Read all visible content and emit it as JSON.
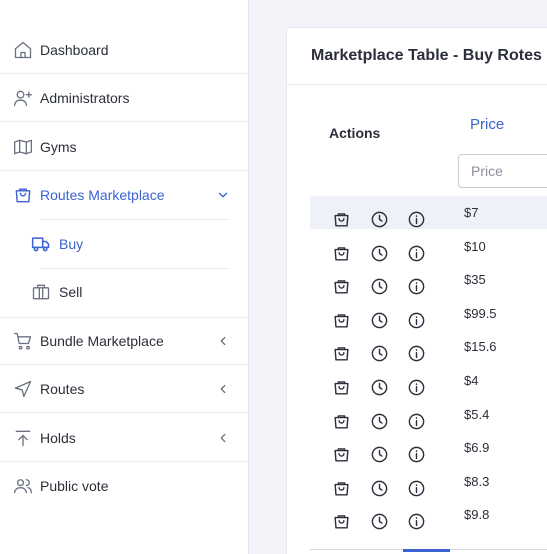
{
  "sidebar": {
    "items": [
      {
        "label": "Dashboard",
        "icon": "home-icon"
      },
      {
        "label": "Administrators",
        "icon": "user-plus-icon"
      },
      {
        "label": "Gyms",
        "icon": "map-icon"
      },
      {
        "label": "Routes Marketplace",
        "icon": "shopping-bag-icon",
        "expanded": true
      },
      {
        "label": "Bundle Marketplace",
        "icon": "shopping-cart-icon"
      },
      {
        "label": "Routes",
        "icon": "navigation-icon"
      },
      {
        "label": "Holds",
        "icon": "upload-icon"
      },
      {
        "label": "Public vote",
        "icon": "users-icon"
      }
    ],
    "subitems": [
      {
        "label": "Buy",
        "icon": "truck-icon",
        "active": true
      },
      {
        "label": "Sell",
        "icon": "briefcase-icon"
      }
    ],
    "accent_color": "#3b63d1"
  },
  "main": {
    "title": "Marketplace Table - Buy Rotes",
    "table": {
      "columns": [
        "Actions",
        "Price"
      ],
      "price_filter_placeholder": "Price",
      "rows": [
        {
          "price": "$7"
        },
        {
          "price": "$10"
        },
        {
          "price": "$35"
        },
        {
          "price": "$99.5"
        },
        {
          "price": "$15.6"
        },
        {
          "price": "$4"
        },
        {
          "price": "$5.4"
        },
        {
          "price": "$6.9"
        },
        {
          "price": "$8.3"
        },
        {
          "price": "$9.8"
        }
      ],
      "row_actions": [
        "shopping-bag-icon",
        "clock-icon",
        "info-icon"
      ]
    }
  }
}
